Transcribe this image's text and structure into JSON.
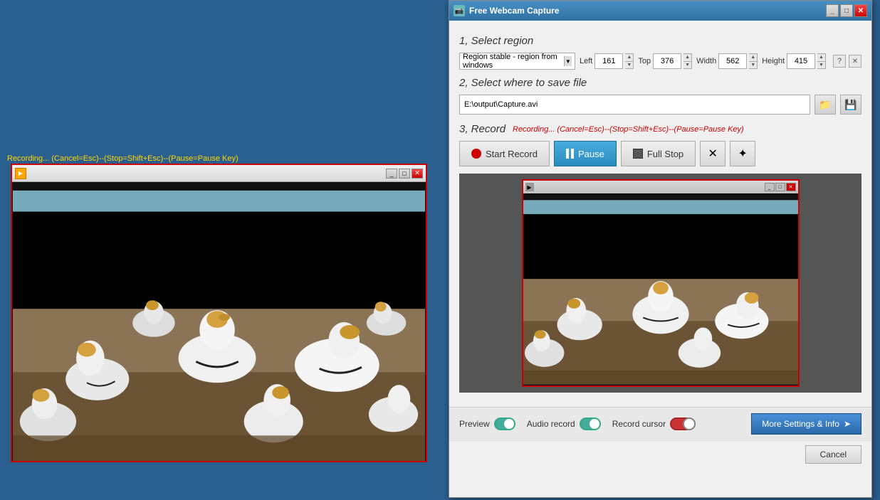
{
  "recording_bar": {
    "text": "Recording... (Cancel=Esc)--(Stop=Shift+Esc)--(Pause=Pause Key)"
  },
  "webcam_window": {
    "title": "",
    "controls": {
      "minimize": "_",
      "maximize": "□",
      "close": "✕"
    }
  },
  "dialog": {
    "title": "Free Webcam Capture",
    "titlebar_controls": {
      "minimize": "_",
      "maximize": "□",
      "close": "✕"
    },
    "section1": {
      "label": "1, Select region"
    },
    "region": {
      "dropdown_value": "Region stable - region from windows",
      "left_label": "Left",
      "left_value": "161",
      "top_label": "Top",
      "top_value": "376",
      "width_label": "Width",
      "width_value": "562",
      "height_label": "Height",
      "height_value": "415"
    },
    "section2": {
      "label": "2, Select where to save file"
    },
    "save": {
      "path": "E:\\output\\Capture.avi",
      "folder_icon": "📁",
      "save_icon": "💾"
    },
    "section3": {
      "label": "3, Record"
    },
    "recording_status": {
      "text": "Recording... (Cancel=Esc)--(Stop=Shift+Esc)--(Pause=Pause Key)"
    },
    "buttons": {
      "start_record": "Start Record",
      "pause": "Pause",
      "full_stop": "Full Stop",
      "x_btn": "✕",
      "sun_btn": "✦"
    },
    "bottom": {
      "preview_label": "Preview",
      "audio_label": "Audio record",
      "cursor_label": "Record cursor",
      "more_settings": "More Settings & Info",
      "more_settings_icon": "➤",
      "cancel": "Cancel"
    },
    "help_icon": "?",
    "close_icon": "✕"
  }
}
